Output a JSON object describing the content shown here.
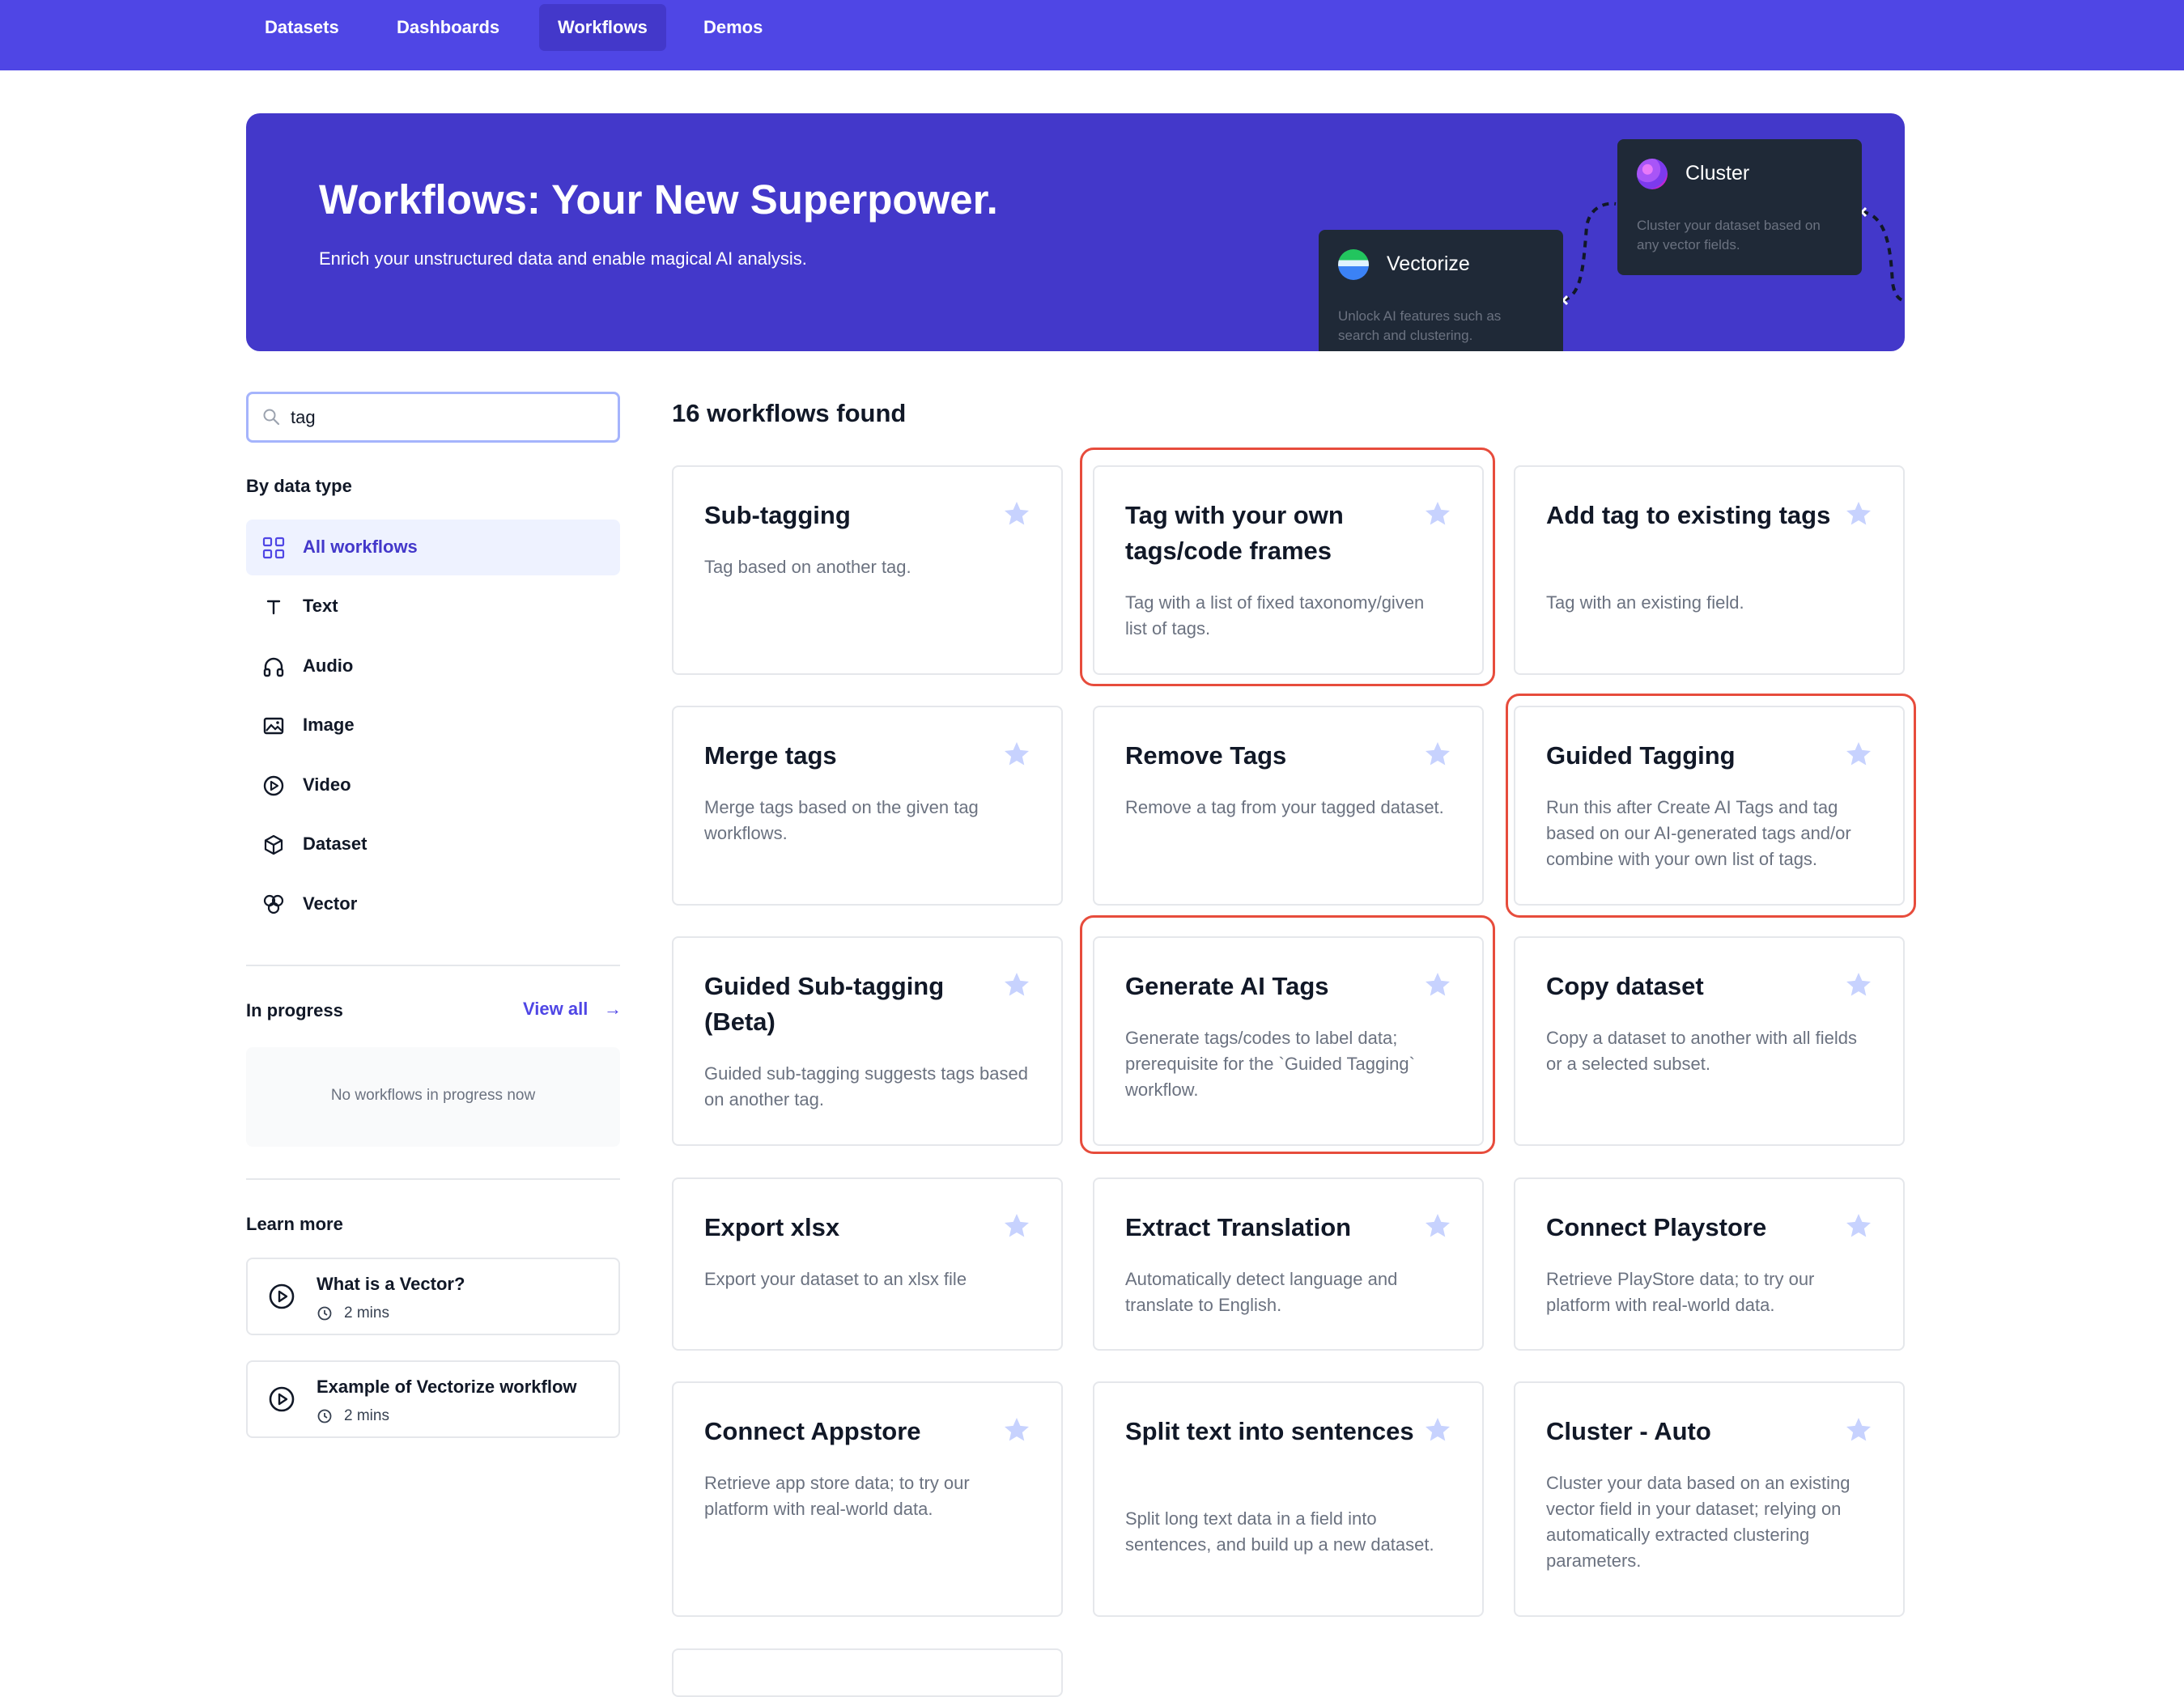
{
  "nav": {
    "items": [
      {
        "label": "Datasets",
        "active": false
      },
      {
        "label": "Dashboards",
        "active": false
      },
      {
        "label": "Workflows",
        "active": true
      },
      {
        "label": "Demos",
        "active": false
      }
    ]
  },
  "hero": {
    "title": "Workflows: Your New Superpower.",
    "subtitle": "Enrich your unstructured data and enable magical AI analysis.",
    "cards": [
      {
        "title": "Cluster",
        "desc": "Cluster your dataset based on any vector fields."
      },
      {
        "title": "Vectorize",
        "desc": "Unlock AI features such as search and clustering."
      }
    ]
  },
  "search": {
    "value": "tag",
    "placeholder": ""
  },
  "filters": {
    "heading": "By data type",
    "items": [
      {
        "label": "All workflows",
        "icon": "grid-icon",
        "active": true
      },
      {
        "label": "Text",
        "icon": "text-icon",
        "active": false
      },
      {
        "label": "Audio",
        "icon": "headphones-icon",
        "active": false
      },
      {
        "label": "Image",
        "icon": "image-icon",
        "active": false
      },
      {
        "label": "Video",
        "icon": "play-circle-icon",
        "active": false
      },
      {
        "label": "Dataset",
        "icon": "cube-icon",
        "active": false
      },
      {
        "label": "Vector",
        "icon": "vector-icon",
        "active": false
      }
    ]
  },
  "in_progress": {
    "heading": "In progress",
    "view_all": "View all",
    "empty": "No workflows in progress now"
  },
  "learn_more": {
    "heading": "Learn more",
    "items": [
      {
        "title": "What is a Vector?",
        "duration": "2 mins"
      },
      {
        "title": "Example of Vectorize workflow",
        "duration": "2 mins"
      }
    ]
  },
  "results": {
    "count_text": "16 workflows found",
    "cards": [
      {
        "title": "Sub-tagging",
        "desc": "Tag based on another tag.",
        "highlighted": false
      },
      {
        "title": "Tag with your own tags/code frames",
        "desc": "Tag with a list of fixed taxonomy/given list of tags.",
        "highlighted": true
      },
      {
        "title": "Add tag to existing tags",
        "desc": "Tag with an existing field.",
        "highlighted": false
      },
      {
        "title": "Merge tags",
        "desc": "Merge tags based on the given tag workflows.",
        "highlighted": false
      },
      {
        "title": "Remove Tags",
        "desc": "Remove a tag from your tagged dataset.",
        "highlighted": false
      },
      {
        "title": "Guided Tagging",
        "desc": "Run this after Create AI Tags and tag based on our AI-generated tags and/or combine with your own list of tags.",
        "highlighted": true
      },
      {
        "title": "Guided Sub-tagging (Beta)",
        "desc": "Guided sub-tagging suggests tags based on another tag.",
        "highlighted": false
      },
      {
        "title": "Generate AI Tags",
        "desc": "Generate tags/codes to label data; prerequisite for the `Guided Tagging` workflow.",
        "highlighted": true
      },
      {
        "title": "Copy dataset",
        "desc": "Copy a dataset to another with all fields or a selected subset.",
        "highlighted": false
      },
      {
        "title": "Export xlsx",
        "desc": "Export your dataset to an xlsx file",
        "highlighted": false
      },
      {
        "title": "Extract Translation",
        "desc": "Automatically detect language and translate to English.",
        "highlighted": false
      },
      {
        "title": "Connect Playstore",
        "desc": "Retrieve PlayStore data; to try our platform with real-world data.",
        "highlighted": false
      },
      {
        "title": "Connect Appstore",
        "desc": "Retrieve app store data; to try our platform with real-world data.",
        "highlighted": false
      },
      {
        "title": "Split text into sentences",
        "desc": "Split long text data in a field into sentences, and build up a new dataset.",
        "highlighted": false
      },
      {
        "title": "Cluster - Auto",
        "desc": "Cluster your data based on an existing vector field in your dataset; relying on automatically extracted clustering parameters.",
        "highlighted": false
      }
    ]
  },
  "colors": {
    "brand": "#4f46e5",
    "hero": "#4338ca",
    "highlight": "#e74c3c",
    "star": "#c7d2fe"
  }
}
